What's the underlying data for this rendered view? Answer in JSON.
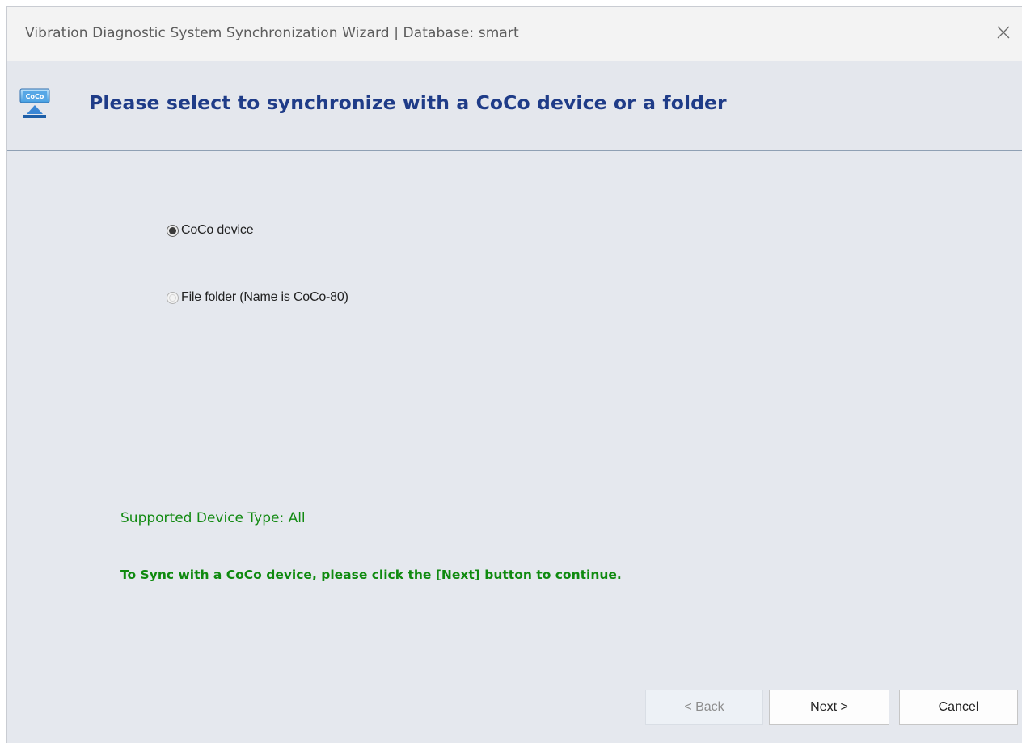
{
  "window": {
    "title": "Vibration Diagnostic System Synchronization Wizard | Database: smart",
    "close_icon": "close-icon"
  },
  "header": {
    "icon": "coco-device-icon",
    "title": "Please select to synchronize with a CoCo device or a folder"
  },
  "options": [
    {
      "label": "CoCo device",
      "checked": true
    },
    {
      "label": "File folder (Name is CoCo-80)",
      "checked": false
    }
  ],
  "info": {
    "supported_device_type": "Supported Device Type:  All",
    "instruction": "To Sync with a CoCo device, please click the [Next] button to continue."
  },
  "buttons": {
    "back": "< Back",
    "next": "Next >",
    "cancel": "Cancel",
    "back_enabled": false
  },
  "colors": {
    "header_title": "#1f3c88",
    "info_text": "#128a12",
    "background": "#e5e8ee"
  }
}
